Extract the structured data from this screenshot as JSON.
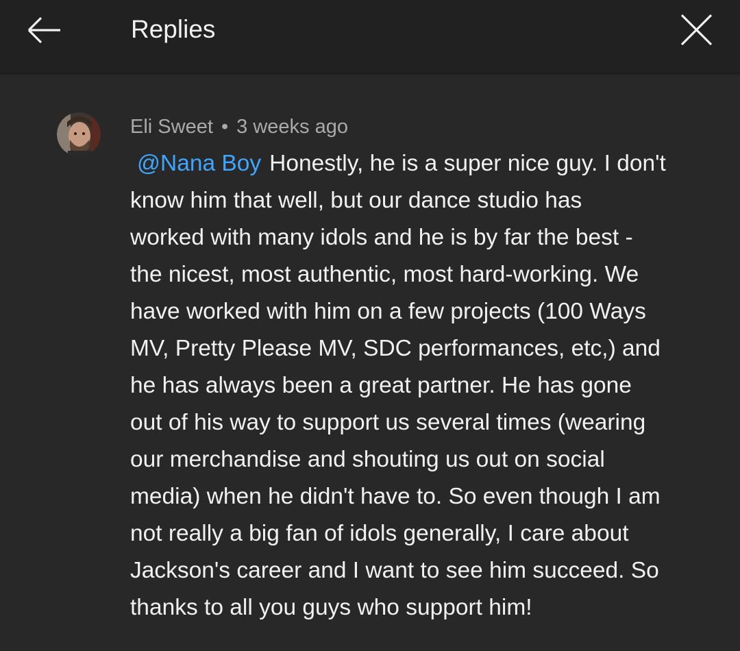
{
  "header": {
    "title": "Replies",
    "back_icon": "arrow-left-icon",
    "close_icon": "close-icon"
  },
  "comment": {
    "author": "Eli Sweet",
    "separator": "•",
    "time": "3 weeks ago",
    "mention": "@Nana Boy",
    "text": "Honestly, he is a super nice guy. I don't\nknow him that well, but our dance studio has\nworked with many idols and he is by far the best -\nthe nicest, most authentic, most hard-working. We\nhave worked with him on a few projects (100 Ways\nMV, Pretty Please MV, SDC performances, etc,) and\nhe has always been a great partner. He has gone\nout of his way to support us several times (wearing\nour merchandise and shouting us out on social\nmedia) when he didn't have to. So even though I am\nnot really a big fan of idols generally, I care about\nJackson's career and I want to see him succeed. So\nthanks to all you guys who support him!",
    "mention_color": "#3ea6ff"
  },
  "colors": {
    "background": "#282828",
    "header_background": "#212121",
    "text_primary": "#f1f1f1",
    "text_secondary": "#aaaaaa"
  }
}
